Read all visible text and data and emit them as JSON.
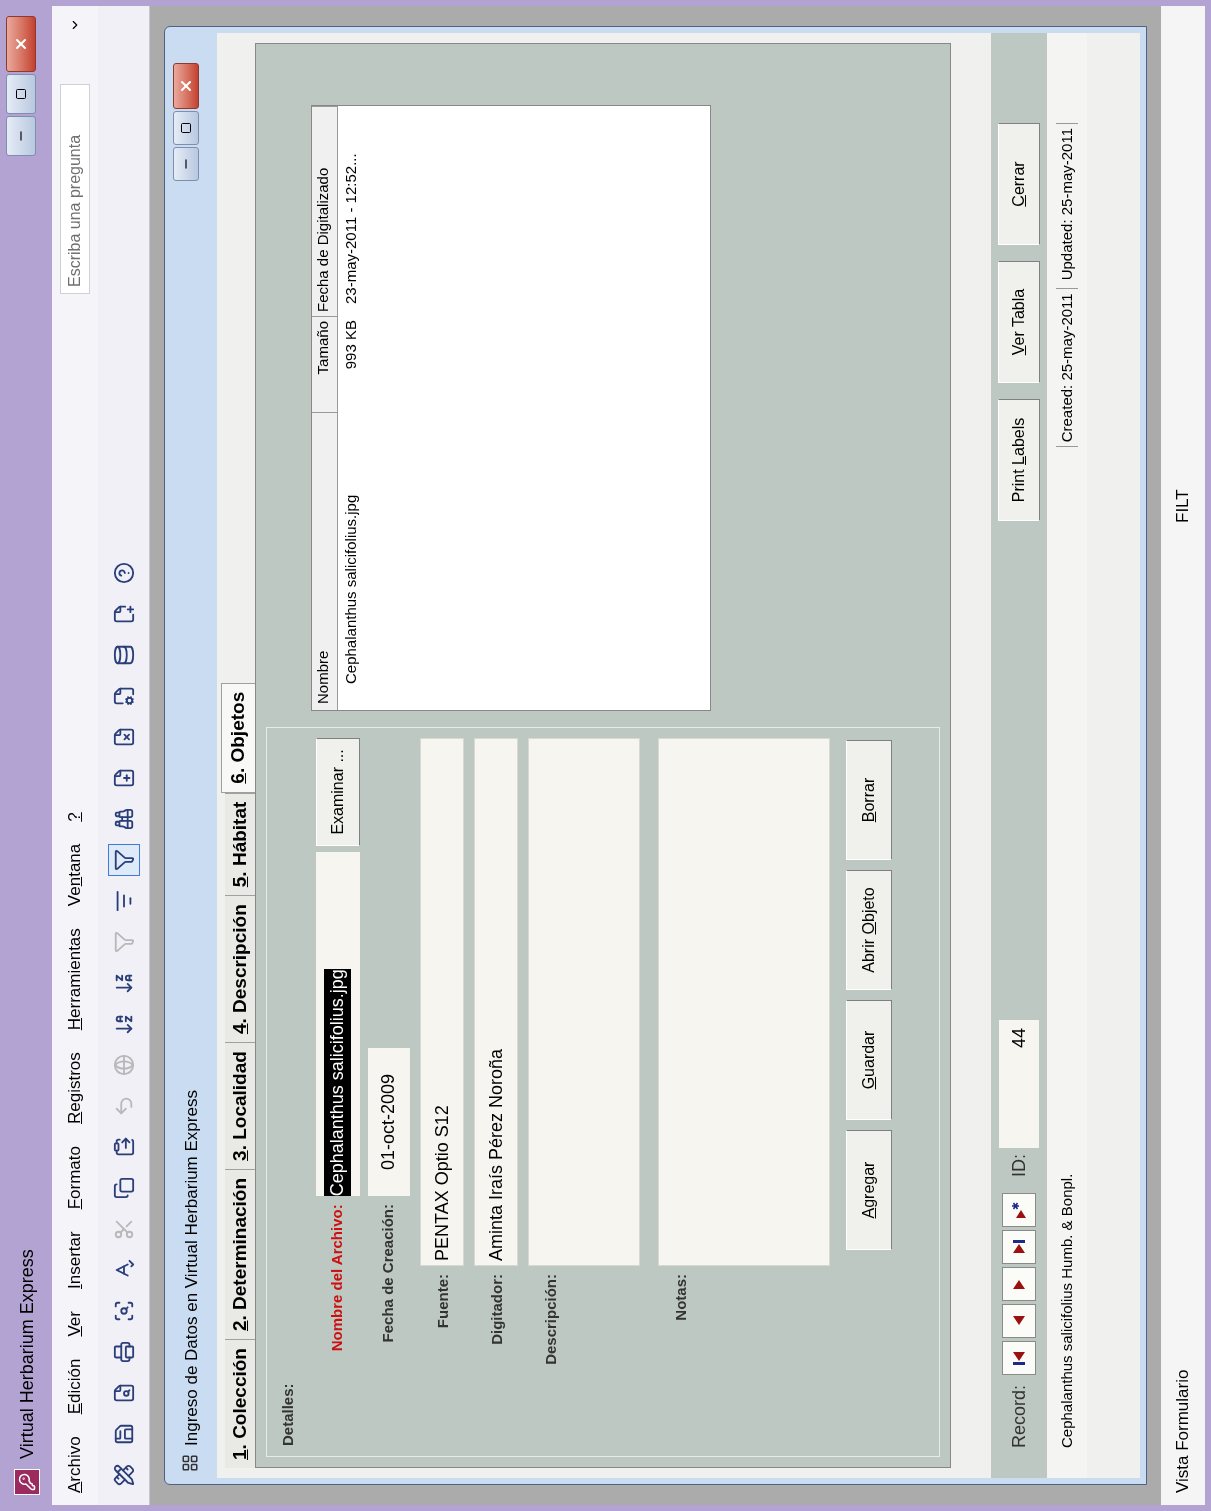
{
  "window": {
    "title": "Virtual Herbarium Express"
  },
  "menu": [
    {
      "key": "A",
      "after": "rchivo"
    },
    {
      "key": "E",
      "after": "dición"
    },
    {
      "key": "V",
      "after": "er"
    },
    {
      "key": "I",
      "after": "nsertar"
    },
    {
      "key": "F",
      "after": "ormato"
    },
    {
      "key": "R",
      "after": "egistros"
    },
    {
      "key": "H",
      "after": "erramientas"
    },
    {
      "before": "Ve",
      "key": "n",
      "after": "tana"
    },
    {
      "key": "?"
    }
  ],
  "question_box": {
    "placeholder": "Escriba una pregunta"
  },
  "toolbar": [
    {
      "kind": "design",
      "disabled": false
    },
    {
      "kind": "save",
      "disabled": false
    },
    {
      "kind": "search",
      "disabled": false
    },
    {
      "kind": "print",
      "disabled": false
    },
    {
      "kind": "preview",
      "disabled": false
    },
    {
      "kind": "spelling",
      "disabled": false
    },
    {
      "kind": "cut",
      "disabled": true
    },
    {
      "kind": "copy",
      "disabled": false
    },
    {
      "kind": "paste",
      "disabled": false
    },
    {
      "kind": "undo",
      "disabled": true
    },
    {
      "kind": "hyperlink",
      "disabled": true
    },
    {
      "kind": "sort_asc",
      "disabled": false
    },
    {
      "kind": "sort_desc",
      "disabled": false
    },
    {
      "kind": "filter_selection",
      "disabled": true
    },
    {
      "kind": "filter_form",
      "disabled": false
    },
    {
      "kind": "filter_apply",
      "disabled": false,
      "pressed": true
    },
    {
      "kind": "find",
      "disabled": false
    },
    {
      "kind": "new_record",
      "disabled": false
    },
    {
      "kind": "delete_record",
      "disabled": false
    },
    {
      "kind": "properties",
      "disabled": false
    },
    {
      "kind": "database",
      "disabled": false
    },
    {
      "kind": "new_object",
      "disabled": false
    },
    {
      "kind": "help",
      "disabled": false
    }
  ],
  "form_window": {
    "title": "Ingreso de Datos en Virtual Herbarium Express",
    "tabs": [
      {
        "key": "1",
        "after": ". Colección",
        "selected": false
      },
      {
        "key": "2",
        "after": ". Determinación",
        "selected": false
      },
      {
        "key": "3",
        "after": ". Localidad",
        "selected": false
      },
      {
        "key": "4",
        "after": ". Descripción",
        "selected": false
      },
      {
        "key": "5",
        "after": ". Hábitat",
        "selected": false
      },
      {
        "key": "6",
        "after": ". Objetos",
        "selected": true
      }
    ],
    "section_title": "Detalles:",
    "file_field": {
      "label": "Nombre del Archivo:",
      "value": "Cephalanthus salicifolius.jpg",
      "required": true,
      "highlighted": true
    },
    "browse_button": "Examinar ...",
    "date_field": {
      "label": "Fecha de Creación:",
      "value": "01-oct-2009",
      "required": false
    },
    "fields": [
      {
        "label": "Fuente:",
        "value": "PENTAX Optio S12",
        "kind": "line",
        "required": false
      },
      {
        "label": "Digitador:",
        "value": "Aminta Iraís Pérez Noroña",
        "kind": "line",
        "required": false
      },
      {
        "label": "Descripción:",
        "kind": "memo",
        "required": false
      },
      {
        "label": "Notas:",
        "kind": "memo_large",
        "required": false
      }
    ],
    "object_buttons": [
      {
        "key": "A",
        "after": "gregar"
      },
      {
        "key": "G",
        "after": "uardar"
      },
      {
        "before": "Abrir ",
        "key": "O",
        "after": "bjeto"
      },
      {
        "key": "B",
        "after": "orrar"
      }
    ],
    "objects_list": {
      "headers": [
        "Nombre",
        "Tamaño",
        "Fecha de Digitalizado"
      ],
      "items": [
        {
          "name": "Cephalanthus salicifolius.jpg",
          "size": "993 KB",
          "digitized": "23-may-2011 - 12:52..."
        }
      ]
    },
    "record_nav": {
      "label": "Record:",
      "id_label": "ID:",
      "id_value": "44"
    },
    "action_buttons": [
      {
        "before": "Print ",
        "key": "L",
        "after": "abels"
      },
      {
        "key": "V",
        "after": "er Tabla"
      },
      {
        "key": "C",
        "after": "errar"
      }
    ],
    "status_text": "Cephalanthus salicifolius Humb. & Bonpl.",
    "created": "Created: 25-may-2011",
    "updated": "Updated: 25-may-2011"
  },
  "status_bar": {
    "mode": "Vista Formulario",
    "filter": "FILT"
  }
}
